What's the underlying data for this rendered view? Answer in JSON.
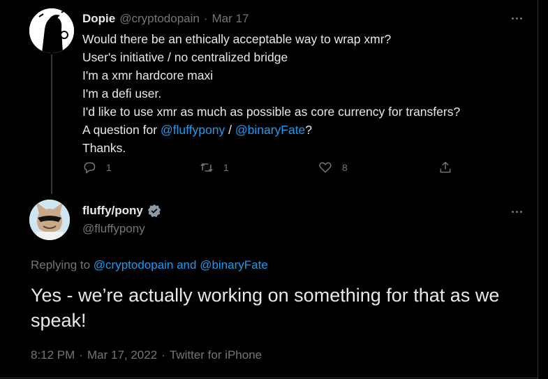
{
  "parent_tweet": {
    "name": "Dopie",
    "handle": "@cryptodopain",
    "separator": "·",
    "date": "Mar 17",
    "lines": [
      "Would there be an ethically acceptable way to wrap xmr?",
      "User's initiative / no centralized bridge",
      "I'm a xmr hardcore maxi",
      "I'm a defi user.",
      "I'd like to use xmr as much as possible as core currency for transfers?"
    ],
    "question_prefix": "A question for ",
    "mention_1": "@fluffypony",
    "question_sep": " / ",
    "mention_2": "@binaryFate",
    "question_suffix": "?",
    "closing": "Thanks.",
    "reply_count": "1",
    "retweet_count": "1",
    "like_count": "8"
  },
  "main_tweet": {
    "name": "fluffy/pony",
    "handle": "@fluffypony",
    "replying_prefix": "Replying to ",
    "replying_to": "@cryptodopain and @binaryFate",
    "text": "Yes - we’re actually working on something for that as we speak!",
    "time": "8:12 PM",
    "separator": "·",
    "date": "Mar 17, 2022",
    "separator_2": "·",
    "source": "Twitter for iPhone"
  },
  "colors": {
    "background": "#000000",
    "text": "#e7e9ea",
    "muted": "#71767b",
    "link": "#1d9bf0"
  },
  "icons": [
    "reply-icon",
    "retweet-icon",
    "like-icon",
    "share-icon",
    "verified-badge-icon",
    "more-icon"
  ]
}
